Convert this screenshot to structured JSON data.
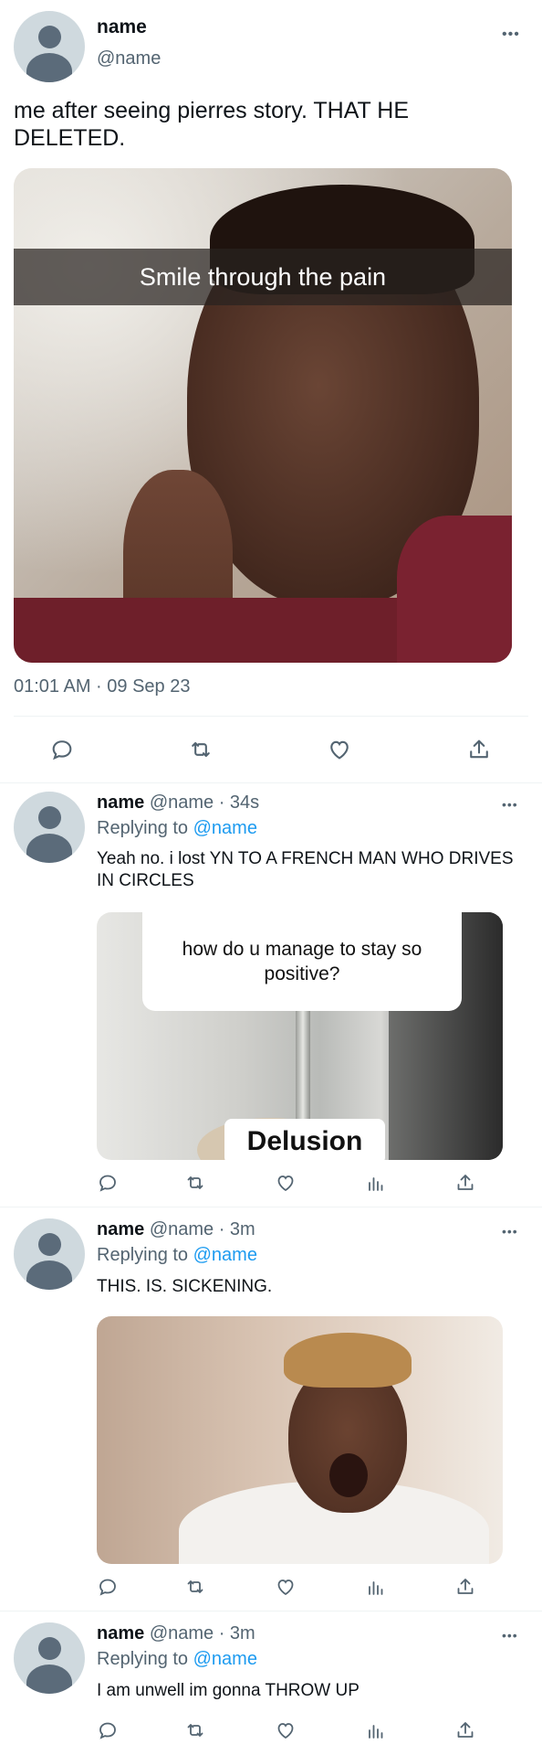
{
  "main_tweet": {
    "display_name": "name",
    "handle": "@name",
    "more_label": "•••",
    "text": "me after seeing pierres story. THAT HE DELETED.",
    "image_caption": "Smile through the pain",
    "timestamp": "01:01 AM · 09 Sep 23"
  },
  "replies": [
    {
      "display_name": "name",
      "handle": "@name",
      "time": "· 34s",
      "replying_prefix": "Replying to",
      "replying_handle": "@name",
      "text": "Yeah no. i lost YN TO A FRENCH MAN WHO DRIVES IN CIRCLES",
      "image_question": "how do u manage to stay so positive?",
      "image_answer": "Delusion"
    },
    {
      "display_name": "name",
      "handle": "@name",
      "time": "· 3m",
      "replying_prefix": "Replying to",
      "replying_handle": "@name",
      "text": "THIS. IS. SICKENING."
    },
    {
      "display_name": "name",
      "handle": "@name",
      "time": "· 3m",
      "replying_prefix": "Replying to",
      "replying_handle": "@name",
      "text": "I am unwell im gonna THROW UP"
    }
  ],
  "icons": {
    "reply": "reply-icon",
    "retweet": "retweet-icon",
    "like": "heart-icon",
    "views": "views-icon",
    "share": "share-icon"
  },
  "colors": {
    "link": "#1d9bf0",
    "secondary_text": "#536471",
    "divider": "#eff3f4"
  }
}
